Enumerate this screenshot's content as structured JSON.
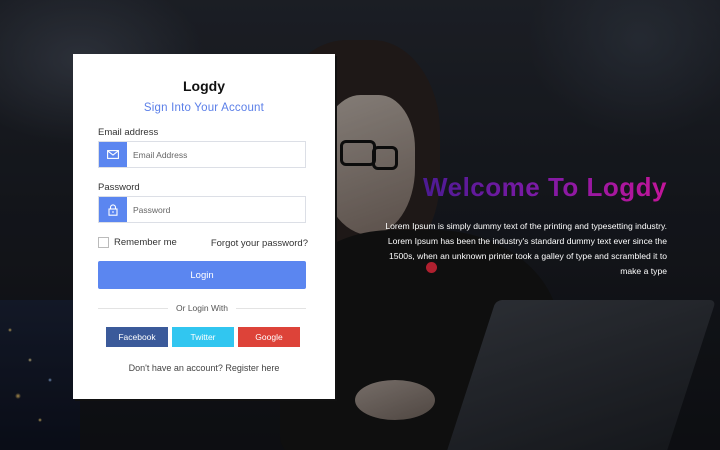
{
  "brand": {
    "name": "Logdy",
    "subtitle": "Sign Into Your Account"
  },
  "form": {
    "email_label": "Email address",
    "email_placeholder": "Email Address",
    "email_value": "",
    "password_label": "Password",
    "password_placeholder": "Password",
    "password_value": "",
    "remember_label": "Remember me",
    "remember_checked": false,
    "forgot_label": "Forgot your password?",
    "login_label": "Login",
    "divider_text": "Or Login With"
  },
  "social": {
    "facebook": "Facebook",
    "twitter": "Twitter",
    "google": "Google"
  },
  "footer": {
    "register_text": "Don't have an account? Register here"
  },
  "hero": {
    "title": "Welcome To Logdy",
    "body": "Lorem Ipsum is simply dummy text of the printing and typesetting industry. Lorem Ipsum has been the industry's standard dummy text ever since the 1500s, when an unknown printer took a galley of type and scrambled it to make a type"
  },
  "icons": {
    "email": "envelope-icon",
    "password": "lock-icon"
  },
  "colors": {
    "accent": "#5b86f0",
    "subtitle": "#5b7fe8",
    "facebook": "#3b5a9a",
    "twitter": "#31c6f0",
    "google": "#dd4339",
    "hero_gradient_start": "#3a1b8c",
    "hero_gradient_end": "#c4159a"
  }
}
